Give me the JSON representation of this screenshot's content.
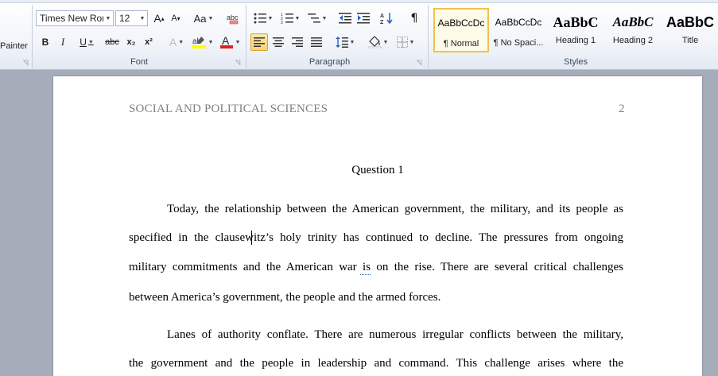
{
  "ribbon": {
    "clipboard": {
      "format_painter_label": "Painter"
    },
    "font": {
      "group_label": "Font",
      "font_name": "Times New Rom",
      "font_size": "12",
      "grow_label": "A",
      "shrink_label": "A",
      "case_label": "Aa",
      "bold": "B",
      "italic": "I",
      "underline": "U",
      "strike": "abc",
      "subscript": "x₂",
      "superscript": "x²",
      "effects": "A",
      "font_color": "A"
    },
    "paragraph": {
      "group_label": "Paragraph"
    },
    "styles": {
      "group_label": "Styles",
      "items": [
        {
          "sample": "AaBbCcDc",
          "name": "¶ Normal"
        },
        {
          "sample": "AaBbCcDc",
          "name": "¶ No Spaci..."
        },
        {
          "sample": "AaBbC",
          "name": "Heading 1"
        },
        {
          "sample": "AaBbC",
          "name": "Heading 2"
        },
        {
          "sample": "AaBbC",
          "name": "Title"
        }
      ]
    },
    "colors": {
      "highlight": "#ffff00",
      "font_color": "#e0201b",
      "active": "#fbd474"
    }
  },
  "document": {
    "header_title": "SOCIAL AND POLITICAL SCIENCES",
    "page_number": "2",
    "question_title": "Question 1",
    "p1": [
      "Today, the relationship between the American government, the military, and its people as",
      "specified in the clausewitz’s holy trinity has continued to decline. The pressures from ongoing",
      "military commitments and the American war is on the rise. There are several critical challenges",
      "between America’s government, the people and the armed forces."
    ],
    "p2": [
      "Lanes of authority conflate. There are numerous irregular conflicts between the military,",
      "the government and the people in leadership and command. This challenge arises where the"
    ]
  }
}
